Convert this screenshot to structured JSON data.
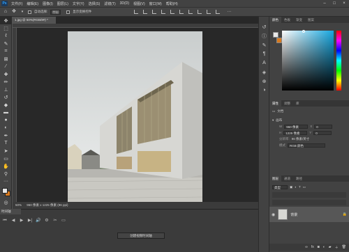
{
  "app": {
    "logo": "Ps"
  },
  "menu": [
    "文件(F)",
    "编辑(E)",
    "图像(I)",
    "图层(L)",
    "文字(Y)",
    "选择(S)",
    "滤镜(T)",
    "3D(D)",
    "视图(V)",
    "窗口(W)",
    "帮助(H)"
  ],
  "window_buttons": [
    "–",
    "□",
    "×"
  ],
  "options": {
    "auto_select_label": "自动选择:",
    "auto_select_value": "图层",
    "show_transform_label": "显示变换控件",
    "more": "···"
  },
  "document": {
    "tab_title": "1.jpg @ 50%(RGB/8#) *",
    "close": "×",
    "zoom": "50%",
    "status": "960 像素 x 1225 像素 (96 ppi)"
  },
  "toolbar_icons": [
    "move-icon",
    "marquee-icon",
    "lasso-icon",
    "quick-select-icon",
    "crop-icon",
    "frame-icon",
    "eyedropper-icon",
    "healing-icon",
    "brush-icon",
    "stamp-icon",
    "history-brush-icon",
    "eraser-icon",
    "gradient-icon",
    "blur-icon",
    "dodge-icon",
    "pen-icon",
    "type-icon",
    "path-select-icon",
    "shape-icon",
    "hand-icon",
    "zoom-icon",
    "more-icon"
  ],
  "timeline": {
    "tab": "时间轴",
    "create_button": "创建视频时间轴",
    "controls": [
      "⏮",
      "◀",
      "▶",
      "▶|",
      "🔊",
      "⚙",
      "✂",
      "▭"
    ]
  },
  "color_panel": {
    "tabs": [
      "颜色",
      "色板",
      "渐变",
      "图案"
    ],
    "hue_color": "#16a7e0"
  },
  "properties_panel": {
    "tabs": [
      "属性",
      "调整",
      "库"
    ],
    "doc_label": "文档",
    "section_label": "画布",
    "width_label": "W",
    "width_value": "960 像素",
    "height_label": "H",
    "height_value": "1225 像素",
    "x_label": "X",
    "y_label": "Y",
    "x_value": "0",
    "y_value": "0",
    "resolution_label": "分辨率:",
    "resolution_value": "96 像素/英寸",
    "mode_label": "模式",
    "mode_value": "RGB 颜色"
  },
  "layers_panel": {
    "tabs": [
      "图层",
      "通道",
      "路径"
    ],
    "filter_label": "类型",
    "layer_name": "背景"
  },
  "colors": {
    "accent": "#2fa3ff",
    "foreground": "#e8e8e8",
    "background": "#d97a1e"
  }
}
